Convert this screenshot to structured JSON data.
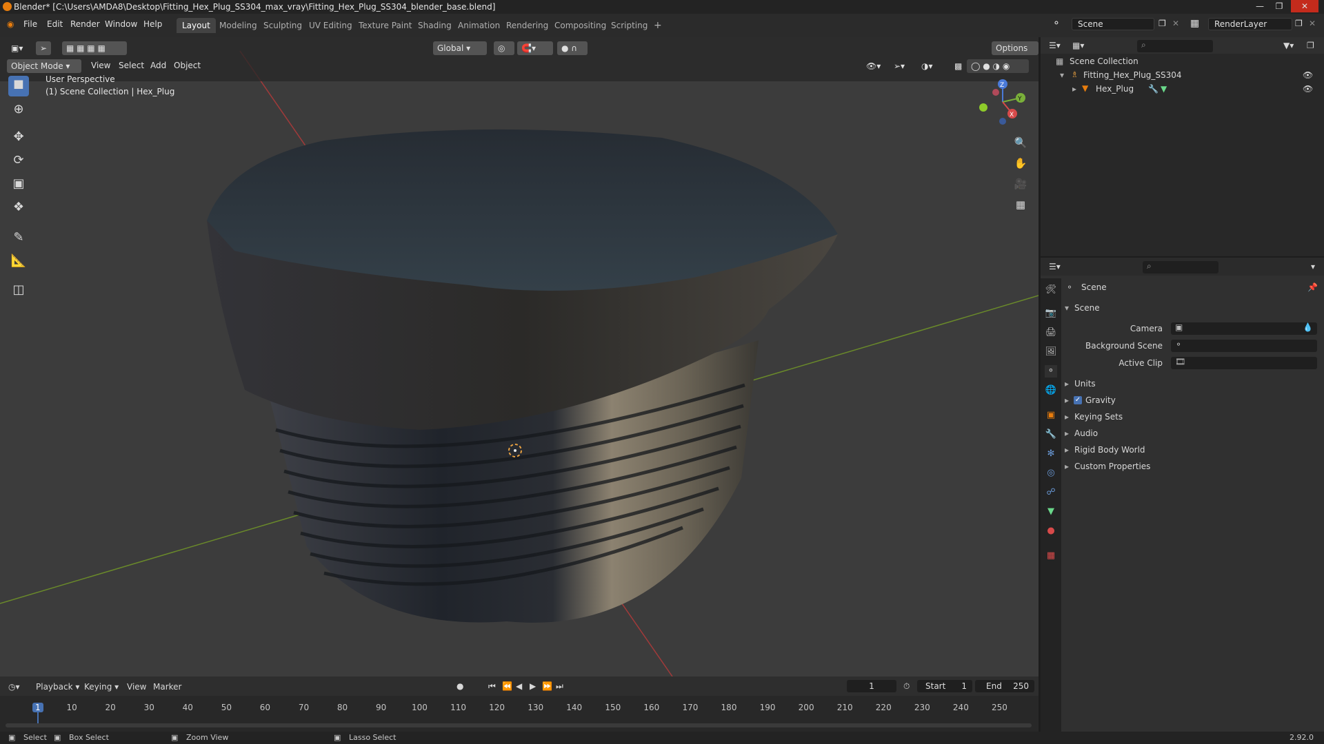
{
  "titlebar": {
    "title": "Blender* [C:\\Users\\AMDA8\\Desktop\\Fitting_Hex_Plug_SS304_max_vray\\Fitting_Hex_Plug_SS304_blender_base.blend]"
  },
  "menu": [
    "File",
    "Edit",
    "Render",
    "Window",
    "Help"
  ],
  "workspaces": [
    "Layout",
    "Modeling",
    "Sculpting",
    "UV Editing",
    "Texture Paint",
    "Shading",
    "Animation",
    "Rendering",
    "Compositing",
    "Scripting"
  ],
  "scene_name": "Scene",
  "render_layer": "RenderLayer",
  "viewport": {
    "mode": "Object Mode",
    "menus": [
      "View",
      "Select",
      "Add",
      "Object"
    ],
    "orientation": "Global",
    "options": "Options",
    "perspective": "User Perspective",
    "collection_info": "(1) Scene Collection | Hex_Plug",
    "gizmo_axes": [
      "Z",
      "Y",
      "X"
    ]
  },
  "outliner": {
    "root": "Scene Collection",
    "collection": "Fitting_Hex_Plug_SS304",
    "object": "Hex_Plug"
  },
  "properties": {
    "header": "Scene",
    "section": "Scene",
    "fields": [
      {
        "label": "Camera"
      },
      {
        "label": "Background Scene"
      },
      {
        "label": "Active Clip"
      }
    ],
    "panels": [
      "Units",
      "Gravity",
      "Keying Sets",
      "Audio",
      "Rigid Body World",
      "Custom Properties"
    ],
    "gravity_checked": true
  },
  "timeline": {
    "menus": [
      "Playback",
      "Keying",
      "View",
      "Marker"
    ],
    "current_frame": "1",
    "start_label": "Start",
    "start": "1",
    "end_label": "End",
    "end": "250",
    "ticks": [
      "1",
      "10",
      "20",
      "30",
      "40",
      "50",
      "60",
      "70",
      "80",
      "90",
      "100",
      "110",
      "120",
      "130",
      "140",
      "150",
      "160",
      "170",
      "180",
      "190",
      "200",
      "210",
      "220",
      "230",
      "240",
      "250"
    ]
  },
  "statusbar": {
    "items": [
      "Select",
      "Box Select",
      "Zoom View",
      "Lasso Select"
    ],
    "version": "2.92.0"
  },
  "colors": {
    "accent": "#4772b3",
    "active_frame": "#4772b3",
    "orange": "#e87d0d"
  }
}
